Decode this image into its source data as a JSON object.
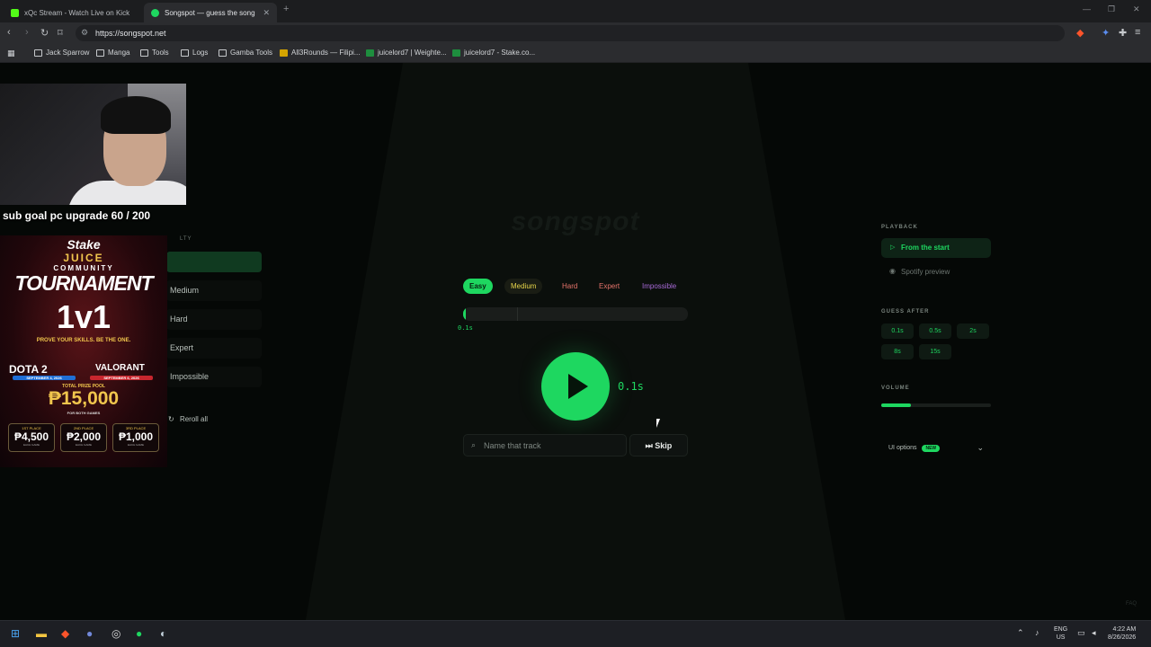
{
  "browser": {
    "tabs": [
      {
        "title": "xQc Stream - Watch Live on Kick",
        "active": false,
        "favicon_color": "#53fc18"
      },
      {
        "title": "Songspot — guess the song",
        "active": true,
        "favicon_color": "#1ed760"
      }
    ],
    "new_tab": "+",
    "url": "https://songspot.net",
    "bookmarks": [
      {
        "label": "Jack Sparrow",
        "icon": "folder-icon"
      },
      {
        "label": "Manga",
        "icon": "folder-icon"
      },
      {
        "label": "Tools",
        "icon": "folder-icon"
      },
      {
        "label": "Logs",
        "icon": "folder-icon"
      },
      {
        "label": "Gamba Tools",
        "icon": "folder-icon"
      },
      {
        "label": "All3Rounds — Filipi...",
        "icon": "site-icon"
      },
      {
        "label": "juicelord7 | Weighte...",
        "icon": "site-icon"
      },
      {
        "label": "juicelord7 - Stake.co...",
        "icon": "site-icon"
      }
    ]
  },
  "game": {
    "logo": "songspot",
    "difficulties": [
      {
        "label": "Easy",
        "selected": true,
        "color": "#1ed760"
      },
      {
        "label": "Medium",
        "selected": false,
        "color": "#e6d44a"
      },
      {
        "label": "Hard",
        "selected": false,
        "color": "#e6746b"
      },
      {
        "label": "Expert",
        "selected": false,
        "color": "#e6746b"
      },
      {
        "label": "Impossible",
        "selected": false,
        "color": "#a86ad8"
      }
    ],
    "progress_label": "0.1s",
    "progress_fraction": 0.01,
    "timer": "0.1s",
    "guess_placeholder": "Name that track",
    "skip_label": "Skip"
  },
  "left_panel": {
    "title_fragment": "LTY",
    "items": [
      "Medium",
      "Hard",
      "Expert",
      "Impossible"
    ],
    "reroll_label": "Reroll all"
  },
  "right_panel": {
    "playback_title": "PLAYBACK",
    "playback_options": [
      {
        "label": "From the start",
        "selected": true
      },
      {
        "label": "Spotify preview",
        "selected": false
      }
    ],
    "guess_after_title": "GUESS AFTER",
    "guess_after_options": [
      "0.1s",
      "0.5s",
      "2s",
      "8s",
      "15s"
    ],
    "volume_title": "VOLUME",
    "volume_fraction": 0.27,
    "ui_options_label": "UI options",
    "ui_options_badge": "NEW",
    "faq": "FAQ"
  },
  "overlay": {
    "sub_goal": "sub goal pc upgrade 60 / 200",
    "promo": {
      "brand": "Stake",
      "juice": "JUICE",
      "community": "COMMUNITY",
      "tournament": "TOURNAMENT",
      "mode": "1v1",
      "slogan": "PROVE YOUR SKILLS. BE THE ONE.",
      "game1": "DOTA 2",
      "game1_date": "SEPTEMBER 4, 2026",
      "game2": "VALORANT",
      "game2_date": "SEPTEMBER 6, 2026",
      "prize_label": "TOTAL PRIZE POOL",
      "prize_pool": "₱15,000",
      "for_both": "FOR BOTH GAMES",
      "prizes": [
        {
          "place": "1ST PLACE",
          "amount": "₱4,500",
          "sub": "EACH GAME"
        },
        {
          "place": "2ND PLACE",
          "amount": "₱2,000",
          "sub": "EACH GAME"
        },
        {
          "place": "3RD PLACE",
          "amount": "₱1,000",
          "sub": "EACH GAME"
        }
      ]
    }
  },
  "taskbar": {
    "lang_top": "ENG",
    "lang_bottom": "US",
    "time": "4:22 AM",
    "date": "8/26/2026"
  }
}
